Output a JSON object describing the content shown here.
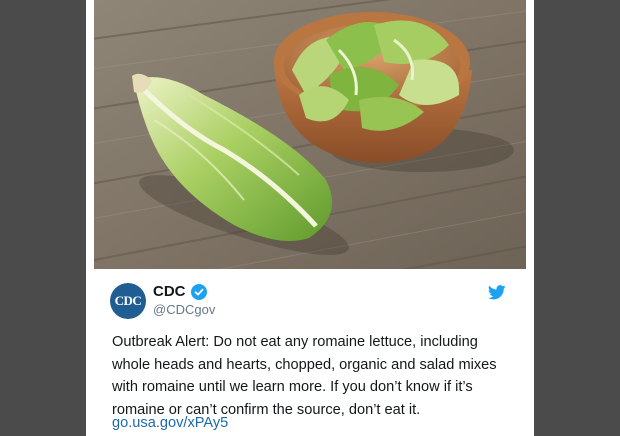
{
  "tweet": {
    "display_name": "CDC",
    "handle": "@CDCgov",
    "avatar_text": "CDC",
    "text": "Outbreak Alert: Do not eat any romaine lettuce, including whole heads and hearts, chopped, organic and salad mixes with romaine until we learn more. If you don’t know if it’s romaine or can’t confirm the source, don’t eat it.",
    "link": "go.usa.gov/xPAy5",
    "verified": true
  },
  "icons": {
    "verified": "verified-badge-icon",
    "platform": "twitter-bird-icon"
  },
  "colors": {
    "avatar": "#1f5d93",
    "verified": "#1da1f2",
    "link": "#1b6aa8",
    "bird": "#1da1f2"
  }
}
